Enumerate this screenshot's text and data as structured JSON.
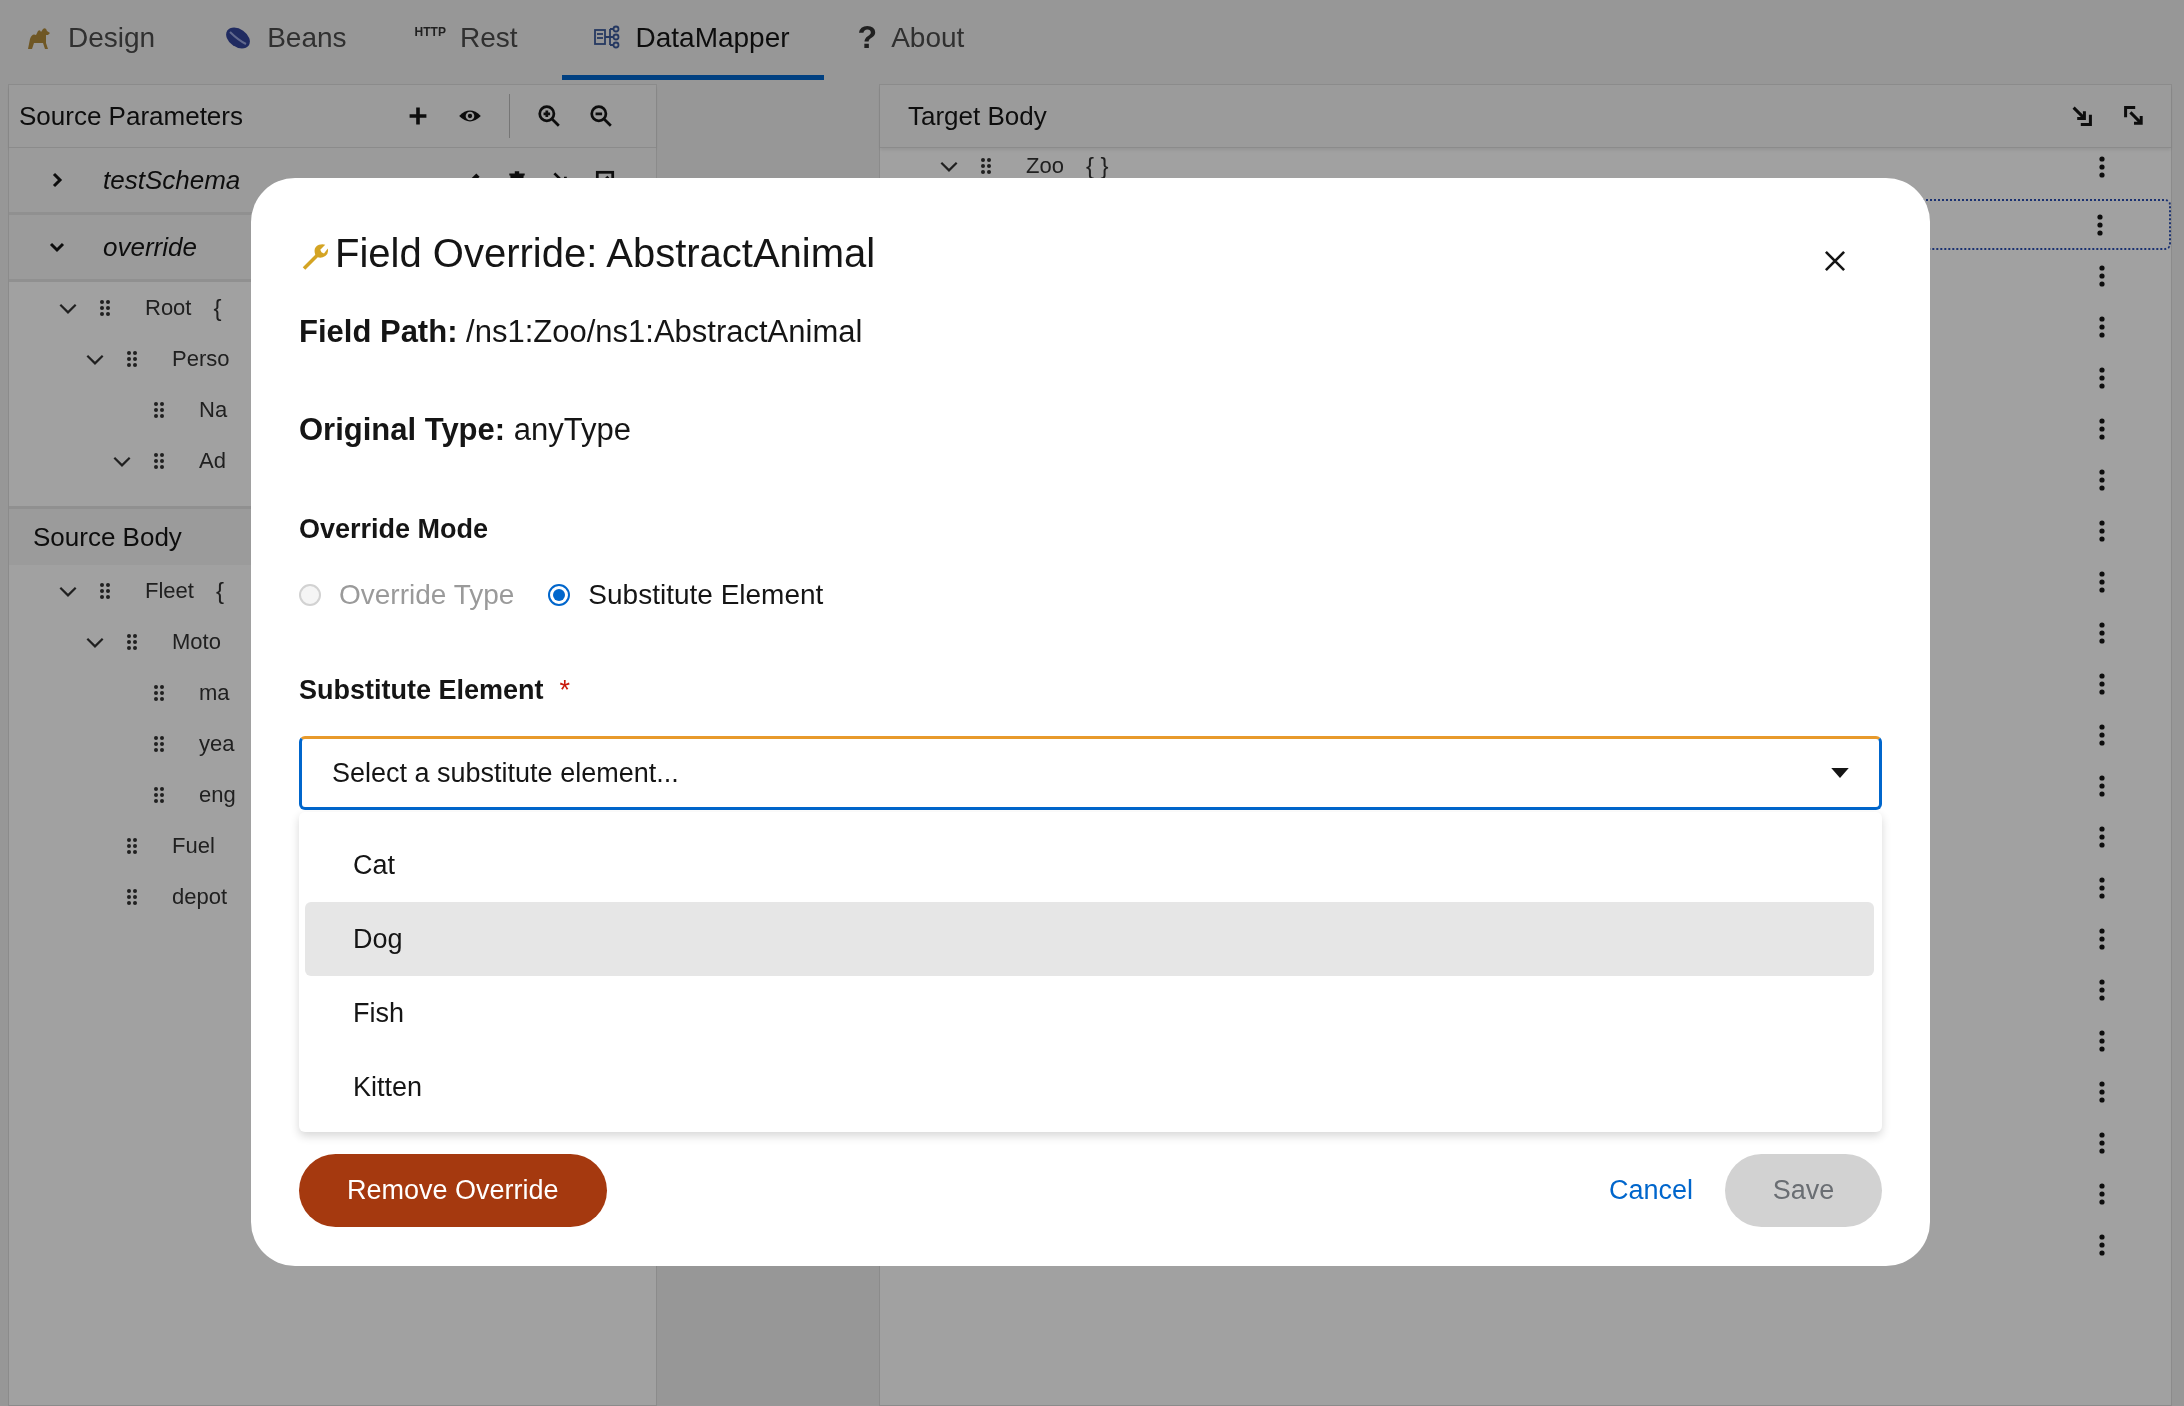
{
  "tabs": [
    {
      "label": "Design",
      "kind": "logo",
      "selected": false
    },
    {
      "label": "Beans",
      "kind": "bean",
      "selected": false
    },
    {
      "label": "Rest",
      "kind": "badge",
      "badge": "HTTP",
      "selected": false
    },
    {
      "label": "DataMapper",
      "kind": "mapper",
      "selected": true
    },
    {
      "label": "About",
      "kind": "badge",
      "badge": "?",
      "selected": false
    }
  ],
  "source_parameters": {
    "title": "Source Parameters",
    "schemas": [
      {
        "name": "testSchema",
        "expanded": false
      },
      {
        "name": "override",
        "expanded": true,
        "children": [
          {
            "name": "Root",
            "brace": "{",
            "expanded": true,
            "children": [
              {
                "name": "Perso",
                "expanded": true,
                "children": [
                  {
                    "name": "Na"
                  },
                  {
                    "name": "Ad",
                    "expanded": true
                  }
                ]
              }
            ]
          }
        ]
      }
    ]
  },
  "source_body": {
    "title": "Source Body",
    "tree": [
      {
        "name": "Fleet",
        "brace": "{",
        "expanded": true,
        "children": [
          {
            "name": "Moto",
            "expanded": true,
            "children": [
              {
                "name": "ma"
              },
              {
                "name": "yea"
              },
              {
                "name": "eng"
              }
            ]
          },
          {
            "name": "Fuel"
          },
          {
            "name": "depot"
          }
        ]
      }
    ]
  },
  "target_body": {
    "title": "Target Body",
    "tree": [
      {
        "name": "Zoo",
        "brace": "{ }",
        "expanded": true
      }
    ]
  },
  "modal": {
    "title": "Field Override: AbstractAnimal",
    "field_path": {
      "label": "Field Path:",
      "value": "/ns1:Zoo/ns1:AbstractAnimal"
    },
    "original_type": {
      "label": "Original Type:",
      "value": "anyType"
    },
    "mode_label": "Override Mode",
    "modes": [
      {
        "label": "Override Type",
        "selected": false,
        "disabled": true
      },
      {
        "label": "Substitute Element",
        "selected": true,
        "disabled": false
      }
    ],
    "select": {
      "label": "Substitute Element",
      "required": true,
      "required_mark": "*",
      "placeholder": "Select a substitute element..."
    },
    "options": [
      {
        "label": "Cat",
        "selected": false
      },
      {
        "label": "Dog",
        "selected": true
      },
      {
        "label": "Fish",
        "selected": false
      },
      {
        "label": "Kitten",
        "selected": false
      }
    ],
    "remove_button": "Remove Override",
    "cancel_link": "Cancel",
    "save_button": {
      "label": "Save",
      "disabled": true
    }
  }
}
